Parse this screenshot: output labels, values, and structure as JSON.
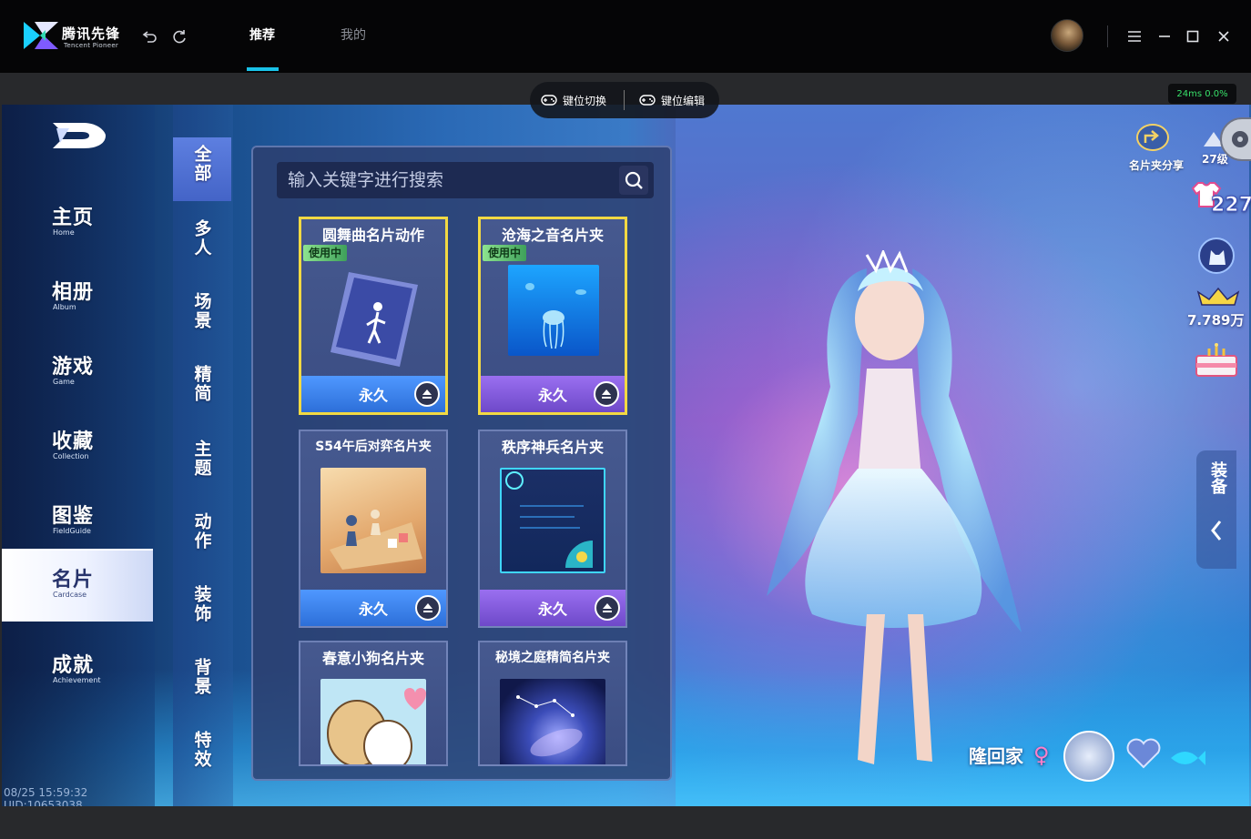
{
  "app": {
    "logo_cn": "腾讯先锋",
    "logo_en": "Tencent Pioneer",
    "tabs": [
      {
        "label": "推荐",
        "active": true
      },
      {
        "label": "我的",
        "active": false
      }
    ],
    "accent_color": "#19c2e8"
  },
  "keybar": {
    "switch_label": "键位切换",
    "edit_label": "键位编辑"
  },
  "ping": "24ms  0.0%",
  "left_menu": {
    "items": [
      {
        "cn": "主页",
        "en": "Home"
      },
      {
        "cn": "相册",
        "en": "Album"
      },
      {
        "cn": "游戏",
        "en": "Game"
      },
      {
        "cn": "收藏",
        "en": "Collection"
      },
      {
        "cn": "图鉴",
        "en": "FieldGuide"
      },
      {
        "cn": "名片",
        "en": "Cardcase",
        "active": true
      },
      {
        "cn": "成就",
        "en": "Achievement"
      }
    ],
    "uid_line": "08/25 15:59:32 UID:10653038"
  },
  "categories": [
    "全部",
    "多人",
    "场景",
    "精简",
    "主题",
    "动作",
    "装饰",
    "背景",
    "特效"
  ],
  "search": {
    "placeholder": "输入关键字进行搜索"
  },
  "cards": [
    {
      "title": "圆舞曲名片动作",
      "badge": "使用中",
      "duration": "永久",
      "selected": true,
      "footer": "blue"
    },
    {
      "title": "沧海之音名片夹",
      "badge": "使用中",
      "duration": "永久",
      "selected": true,
      "footer": "purple"
    },
    {
      "title": "S54午后对弈名片夹",
      "duration": "永久",
      "selected": false,
      "footer": "blue"
    },
    {
      "title": "秩序神兵名片夹",
      "duration": "永久",
      "selected": false,
      "footer": "purple"
    },
    {
      "title": "春意小狗名片夹",
      "selected": false
    },
    {
      "title": "秘境之庭精简名片夹",
      "selected": false
    }
  ],
  "hud": {
    "share_label": "名片夹分享",
    "level": "27级",
    "outfit_count": "227",
    "coins": "7.789万",
    "side_tab": "装备",
    "player_name": "隆回家"
  }
}
